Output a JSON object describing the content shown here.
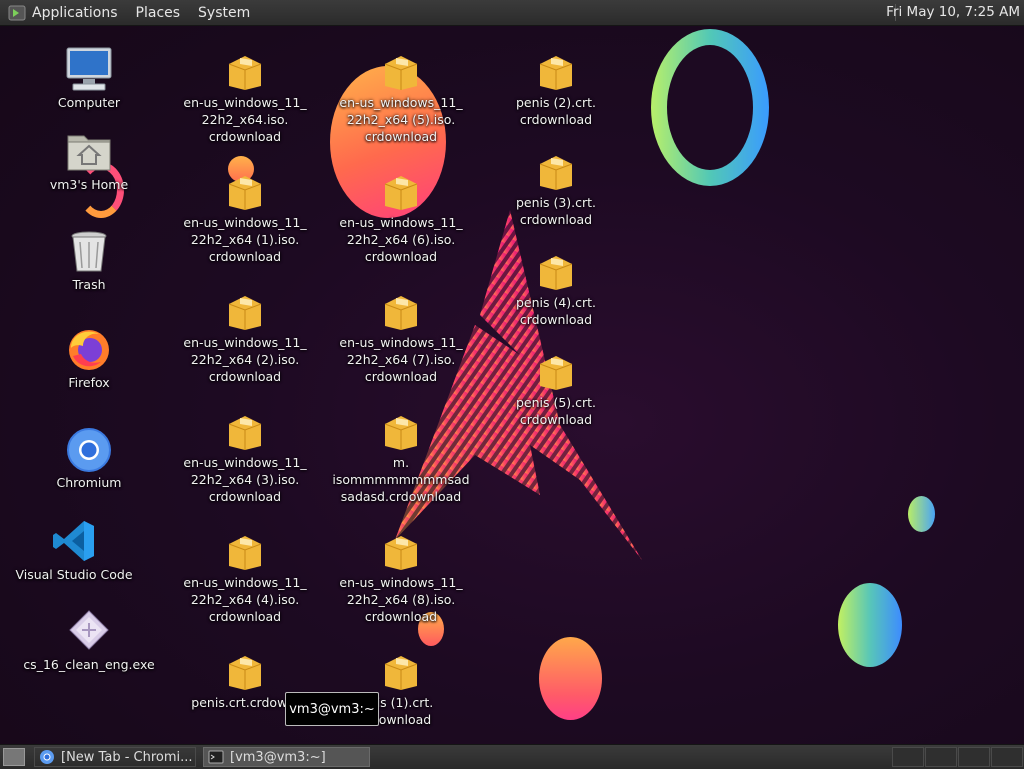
{
  "top_panel": {
    "menus": [
      "Applications",
      "Places",
      "System"
    ],
    "clock": "Fri May 10,  7:25 AM"
  },
  "desktop": {
    "left_icons": [
      {
        "label": "Computer",
        "icon": "computer-icon"
      },
      {
        "label": "vm3's Home",
        "icon": "home-folder-icon"
      },
      {
        "label": "Trash",
        "icon": "trash-icon"
      },
      {
        "label": "Firefox",
        "icon": "firefox-icon"
      },
      {
        "label": "Chromium",
        "icon": "chromium-icon"
      },
      {
        "label": "Visual Studio Code",
        "icon": "vscode-icon"
      },
      {
        "label": "cs_16_clean_eng.exe",
        "icon": "exe-file-icon"
      }
    ],
    "files_col1": [
      "en-us_windows_11_\n22h2_x64.iso.\ncrdownload",
      "en-us_windows_11_\n22h2_x64 (1).iso.\ncrdownload",
      "en-us_windows_11_\n22h2_x64 (2).iso.\ncrdownload",
      "en-us_windows_11_\n22h2_x64 (3).iso.\ncrdownload",
      "en-us_windows_11_\n22h2_x64 (4).iso.\ncrdownload",
      "penis.crt.crdownl"
    ],
    "files_col2": [
      "en-us_windows_11_\n22h2_x64 (5).iso.\ncrdownload",
      "en-us_windows_11_\n22h2_x64 (6).iso.\ncrdownload",
      "en-us_windows_11_\n22h2_x64 (7).iso.\ncrdownload",
      "m.\nisommmmmmmmsad\nsadasd.crdownload",
      "en-us_windows_11_\n22h2_x64 (8).iso.\ncrdownload",
      "nis (1).crt.\ndownload"
    ],
    "files_col3": [
      "penis (2).crt.\ncrdownload",
      "penis (3).crt.\ncrdownload",
      "penis (4).crt.\ncrdownload",
      "penis (5).crt.\ncrdownload"
    ],
    "file_icon": "package-file-icon"
  },
  "tooltip": "vm3@vm3:~",
  "taskbar": {
    "tasks": [
      {
        "label": "[New Tab - Chromi...",
        "icon": "chromium-icon"
      },
      {
        "label": "[vm3@vm3:~]",
        "icon": "terminal-icon"
      }
    ]
  },
  "colors": {
    "panel": "#2f2f2f",
    "desktop_bg": "#1d0a22",
    "accent_pink": "#ff3f7c",
    "accent_orange": "#ffa84a",
    "accent_green": "#b8ef6a",
    "accent_blue": "#3a9bff"
  }
}
